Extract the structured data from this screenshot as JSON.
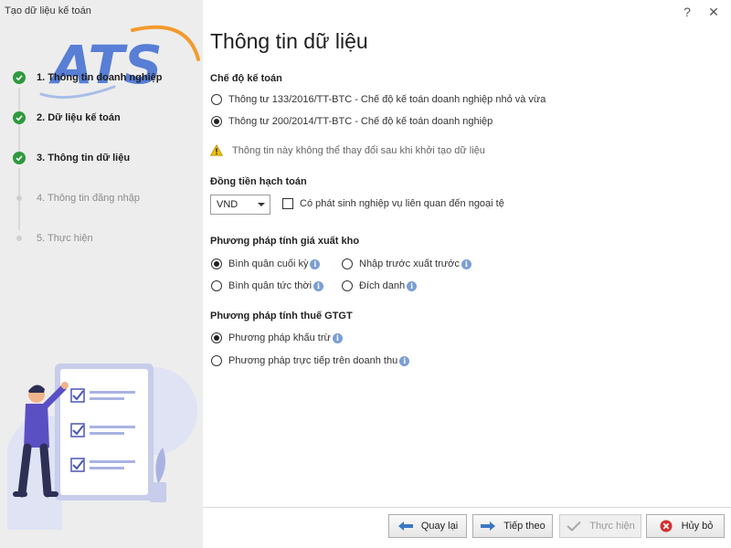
{
  "window": {
    "title": "Tạo dữ liệu kế toán",
    "help_glyph": "?",
    "close_glyph": "✕"
  },
  "logo": {
    "text": "ATS"
  },
  "steps": [
    {
      "label": "1. Thông tin doanh nghiệp",
      "status": "done"
    },
    {
      "label": "2. Dữ liệu kế toán",
      "status": "done"
    },
    {
      "label": "3. Thông tin dữ liệu",
      "status": "done"
    },
    {
      "label": "4. Thông tin đăng nhập",
      "status": "pending"
    },
    {
      "label": "5. Thực hiện",
      "status": "pending"
    }
  ],
  "main": {
    "title": "Thông tin dữ liệu",
    "regime": {
      "heading": "Chế độ kế toán",
      "options": [
        {
          "label": "Thông tư 133/2016/TT-BTC - Chế độ kế toán doanh nghiệp nhỏ và vừa",
          "selected": false
        },
        {
          "label": "Thông tư 200/2014/TT-BTC - Chế độ kế toán doanh nghiệp",
          "selected": true
        }
      ],
      "warning": "Thông tin này không thể thay đổi sau khi khởi tạo dữ liệu"
    },
    "currency": {
      "heading": "Đồng tiền hạch toán",
      "value": "VND",
      "foreign_checkbox_label": "Có phát sinh nghiệp vụ liên quan đến ngoại tệ",
      "foreign_checked": false
    },
    "inventory": {
      "heading": "Phương pháp tính giá xuất kho",
      "options": [
        {
          "label": "Bình quân cuối kỳ",
          "selected": true
        },
        {
          "label": "Nhập trước xuất trước",
          "selected": false
        },
        {
          "label": "Bình quân tức thời",
          "selected": false
        },
        {
          "label": "Đích danh",
          "selected": false
        }
      ]
    },
    "vat": {
      "heading": "Phương pháp tính thuế GTGT",
      "options": [
        {
          "label": "Phương pháp khấu trừ",
          "selected": true
        },
        {
          "label": "Phương pháp trực tiếp trên doanh thu",
          "selected": false
        }
      ]
    },
    "info_glyph": "i"
  },
  "footer": {
    "back_label": "Quay lại",
    "next_label": "Tiếp theo",
    "execute_label": "Thực hiện",
    "cancel_label": "Hủy bỏ"
  },
  "colors": {
    "check_green": "#2e9a3c",
    "accent_blue": "#3b78c4",
    "logo_blue": "#3f6bd1",
    "logo_orange": "#f29a2e",
    "warning_yellow": "#f2c200",
    "cancel_red": "#d32f2f"
  }
}
